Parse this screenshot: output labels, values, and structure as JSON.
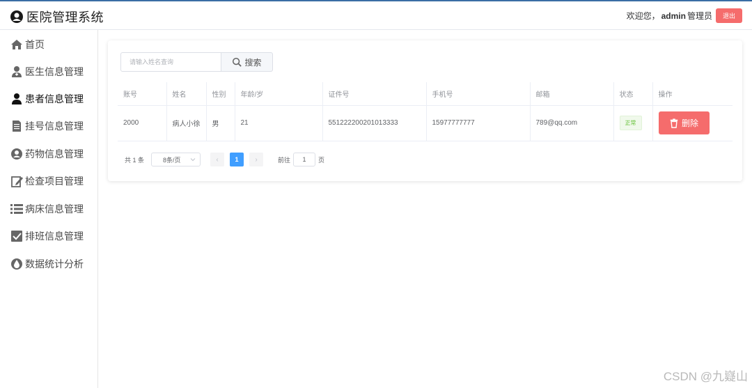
{
  "header": {
    "title": "医院管理系统",
    "welcome": "欢迎您，",
    "username": "admin",
    "role": "管理员",
    "logout_label": "退出"
  },
  "sidebar": {
    "items": [
      {
        "label": "首页",
        "icon": "home-icon"
      },
      {
        "label": "医生信息管理",
        "icon": "doctor-icon"
      },
      {
        "label": "患者信息管理",
        "icon": "patient-icon",
        "active": true
      },
      {
        "label": "挂号信息管理",
        "icon": "document-icon"
      },
      {
        "label": "药物信息管理",
        "icon": "medicine-icon"
      },
      {
        "label": "检查项目管理",
        "icon": "edit-icon"
      },
      {
        "label": "病床信息管理",
        "icon": "list-icon"
      },
      {
        "label": "排班信息管理",
        "icon": "checkbox-icon"
      },
      {
        "label": "数据统计分析",
        "icon": "drop-icon"
      }
    ]
  },
  "search": {
    "placeholder": "请输入姓名查询",
    "value": "",
    "button_label": "搜索"
  },
  "table": {
    "columns": [
      "账号",
      "姓名",
      "性别",
      "年龄/岁",
      "证件号",
      "手机号",
      "邮箱",
      "状态",
      "操作"
    ],
    "rows": [
      {
        "account": "2000",
        "name": "病人小徐",
        "gender": "男",
        "age": "21",
        "id_number": "551222200201013333",
        "phone": "15977777777",
        "email": "789@qq.com",
        "status": "正常",
        "action_label": "删除"
      }
    ]
  },
  "pagination": {
    "total_text": "共 1 条",
    "page_size": "8条/页",
    "prev": "‹",
    "current_page": "1",
    "next": "›",
    "goto_label": "前往",
    "goto_value": "1",
    "page_suffix": "页"
  },
  "watermark": "CSDN @九嶷山",
  "colors": {
    "danger": "#f56c6c",
    "primary": "#409eff",
    "success": "#67c23a",
    "header_border": "#3a6ea5"
  }
}
